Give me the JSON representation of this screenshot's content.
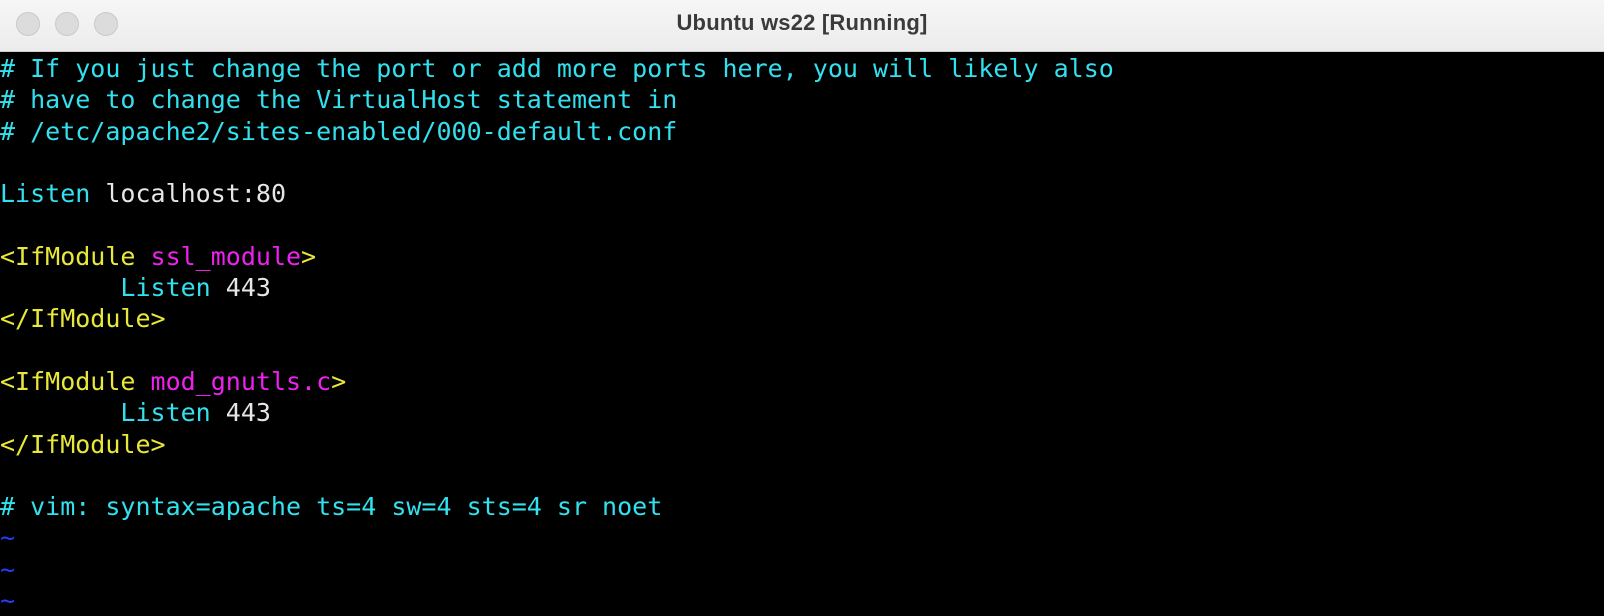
{
  "window": {
    "title": "Ubuntu ws22 [Running]"
  },
  "colors": {
    "comment": "#33e0ee",
    "keyword": "#33e0ee",
    "value": "#e6e6e6",
    "tag": "#e8e83a",
    "module": "#ee22ee",
    "tilde": "#2a3bff",
    "background": "#000000"
  },
  "editor": {
    "lines": {
      "l1": "# If you just change the port or add more ports here, you will likely also",
      "l2": "# have to change the VirtualHost statement in",
      "l3": "# /etc/apache2/sites-enabled/000-default.conf",
      "l5_kw": "Listen",
      "l5_val": "localhost:80",
      "l7_open": "<IfModule",
      "l7_mod": "ssl_module",
      "l7_close": ">",
      "l8_kw": "Listen",
      "l8_val": "443",
      "l9": "</IfModule>",
      "l11_open": "<IfModule",
      "l11_mod": "mod_gnutls.c",
      "l11_close": ">",
      "l12_kw": "Listen",
      "l12_val": "443",
      "l13": "</IfModule>",
      "l15": "# vim: syntax=apache ts=4 sw=4 sts=4 sr noet"
    },
    "empty_line_marker": "~"
  }
}
